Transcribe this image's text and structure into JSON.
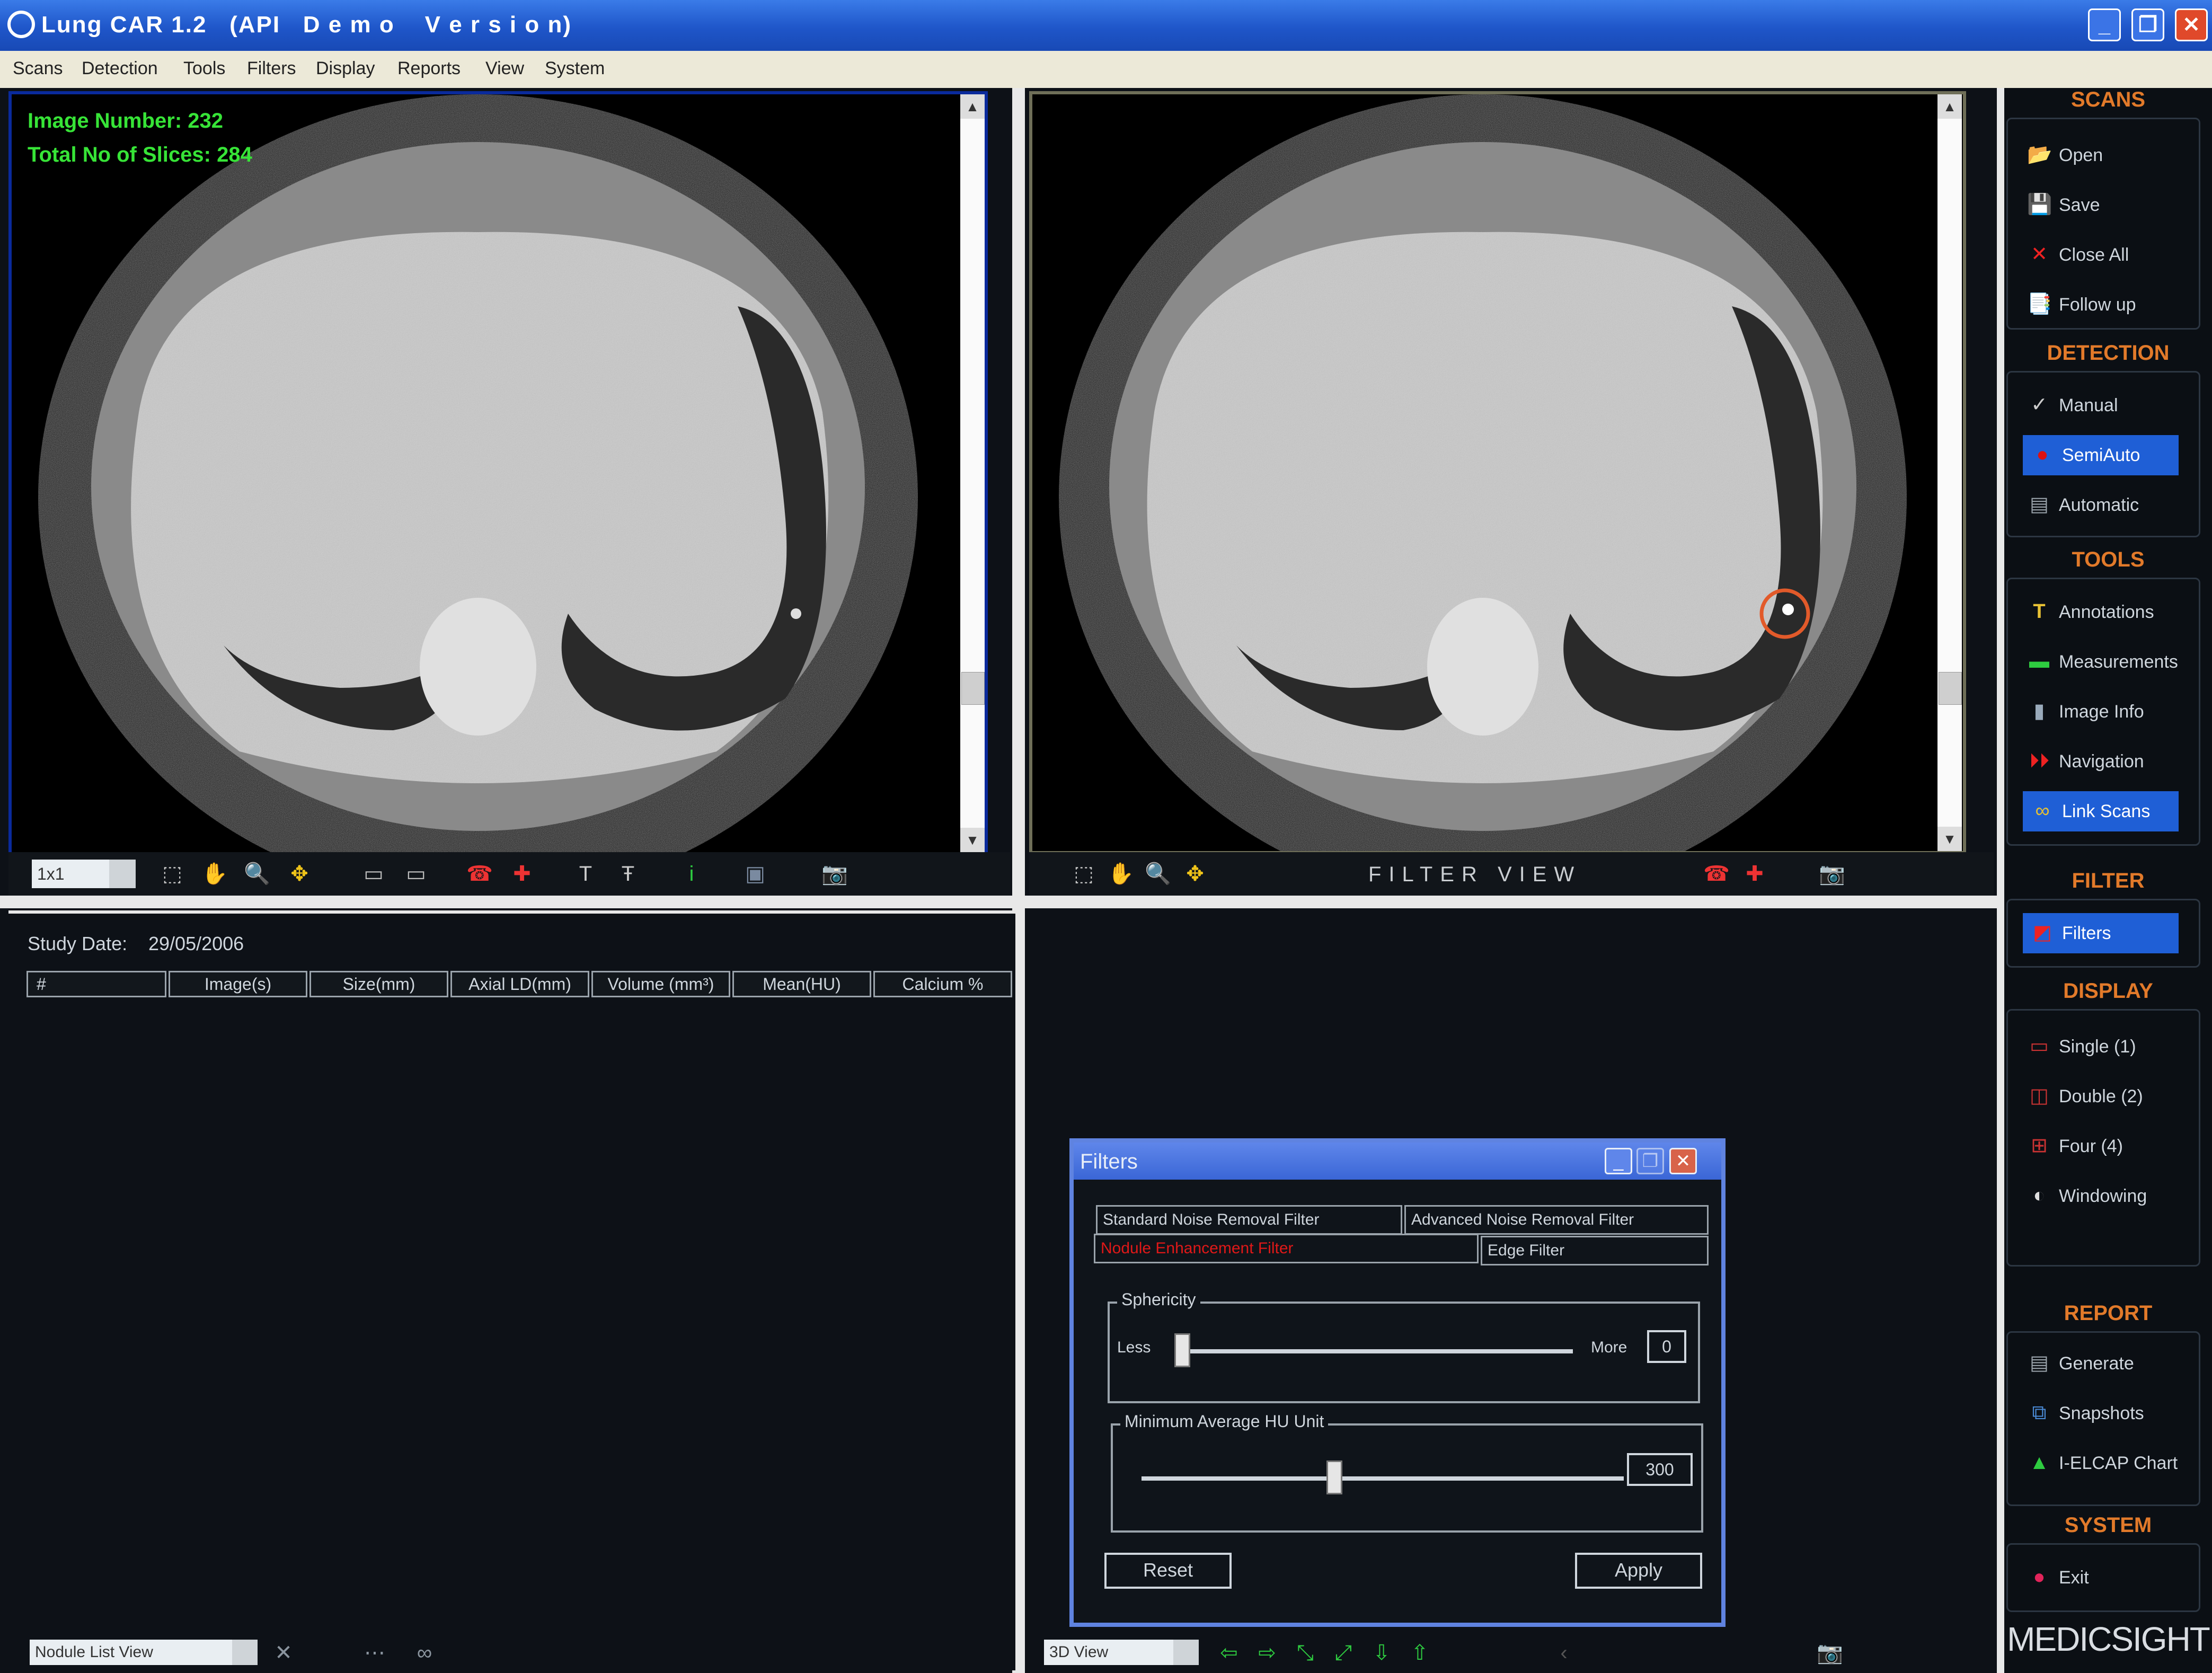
{
  "window": {
    "title": "Lung CAR 1.2   (API   D e m o    V e r s i o n)",
    "min_symbol": "_",
    "max_symbol": "❐",
    "close_symbol": "✕"
  },
  "menu": [
    "Scans",
    "Detection",
    "Tools",
    "Filters",
    "Display",
    "Reports",
    "View",
    "System"
  ],
  "left_view": {
    "image_number_label": "Image Number: 232",
    "total_slices_label": "Total No of Slices: 284",
    "zoom_value": "1x1"
  },
  "right_view": {
    "label": "FILTER VIEW"
  },
  "nodule_panel": {
    "study_date_label": "Study Date:",
    "study_date_value": "29/05/2006",
    "columns": [
      "#",
      "Image(s)",
      "Size(mm)",
      "Axial LD(mm)",
      "Volume (mm³)",
      "Mean(HU)",
      "Calcium %"
    ],
    "view_select": "Nodule List View"
  },
  "view_3d_select": "3D View",
  "filters_dialog": {
    "title": "Filters",
    "tabs_row1": [
      "Standard Noise Removal Filter",
      "Advanced Noise Removal Filter"
    ],
    "tabs_row2": [
      "Nodule Enhancement Filter",
      "Edge Filter"
    ],
    "sphericity": {
      "legend": "Sphericity",
      "less_label": "Less",
      "more_label": "More",
      "value": "0",
      "level": 0.0
    },
    "min_avg_hu": {
      "legend": "Minimum Average HU Unit",
      "value": "300",
      "level": 0.4
    },
    "reset_label": "Reset",
    "apply_label": "Apply"
  },
  "sidebar": {
    "scans": {
      "heading": "SCANS",
      "items": [
        "Open",
        "Save",
        "Close All",
        "Follow up"
      ]
    },
    "detection": {
      "heading": "DETECTION",
      "items": [
        "Manual",
        "SemiAuto",
        "Automatic"
      ]
    },
    "tools": {
      "heading": "TOOLS",
      "items": [
        "Annotations",
        "Measurements",
        "Image Info",
        "Navigation",
        "Link Scans"
      ]
    },
    "filter": {
      "heading": "FILTER",
      "items": [
        "Filters"
      ]
    },
    "display": {
      "heading": "DISPLAY",
      "items": [
        "Single (1)",
        "Double (2)",
        "Four (4)",
        "Windowing"
      ]
    },
    "report": {
      "heading": "REPORT",
      "items": [
        "Generate",
        "Snapshots",
        "I-ELCAP Chart"
      ]
    },
    "system": {
      "heading": "SYSTEM",
      "items": [
        "Exit"
      ]
    },
    "brand": "MEDICSIGHT"
  },
  "colors": {
    "overlay_text": "#37e437",
    "section_heading": "#e27a2a",
    "active_item": "#1f5fd6",
    "active_tab_text": "#e01818",
    "marker_circle": "#e25a2a"
  }
}
